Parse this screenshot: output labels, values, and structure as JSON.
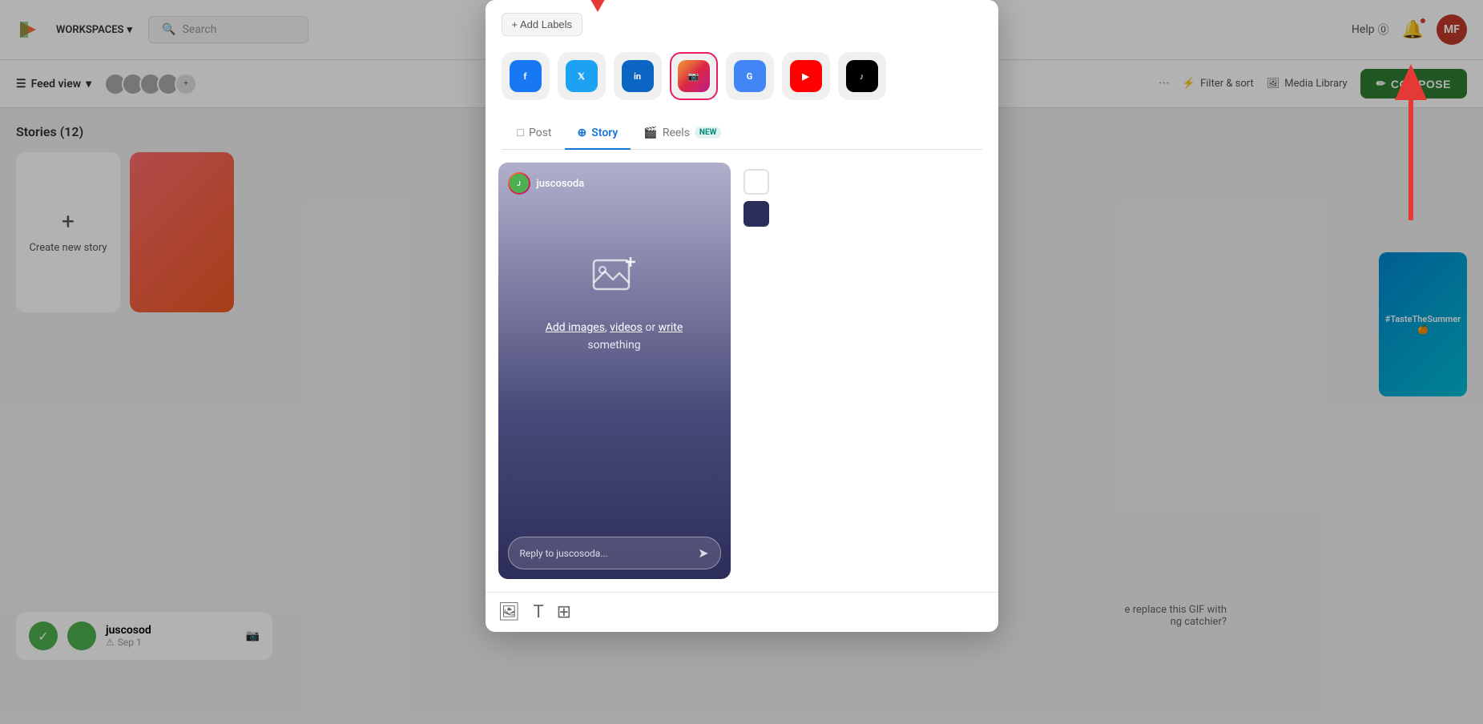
{
  "app": {
    "logo_text": "▶",
    "workspaces_label": "WORKSPACES",
    "search_placeholder": "Search",
    "help_label": "Help",
    "user_initials": "MF",
    "feed_view_label": "Feed view",
    "avatars_count": "3",
    "filter_sort_label": "Filter & sort",
    "media_library_label": "Media Library",
    "compose_label": "COMPOSE"
  },
  "stories": {
    "title": "Stories (12)",
    "create_label": "Create\nnew story"
  },
  "modal": {
    "add_labels_label": "+ Add Labels",
    "tabs": [
      {
        "id": "post",
        "label": "Post",
        "icon": "□",
        "is_new": false
      },
      {
        "id": "story",
        "label": "Story",
        "icon": "⊕",
        "is_new": false,
        "active": true
      },
      {
        "id": "reels",
        "label": "Reels",
        "icon": "🎬",
        "is_new": true
      }
    ],
    "platforms": [
      {
        "id": "facebook",
        "label": "FB",
        "class": "p-fb"
      },
      {
        "id": "twitter",
        "label": "TW",
        "class": "p-tw"
      },
      {
        "id": "linkedin",
        "label": "in",
        "class": "p-li"
      },
      {
        "id": "instagram",
        "label": "IG",
        "class": "p-ig",
        "active": true
      },
      {
        "id": "google",
        "label": "G",
        "class": "p-gg"
      },
      {
        "id": "youtube",
        "label": "YT",
        "class": "p-yt"
      },
      {
        "id": "tiktok",
        "label": "TT",
        "class": "p-tt"
      }
    ],
    "story_preview": {
      "username": "juscosoda",
      "add_images_text": "Add images",
      "videos_text": "videos",
      "or_text": "or",
      "write_text": "write",
      "something_text": "something",
      "reply_placeholder": "Reply to juscosoda..."
    },
    "colors": [
      {
        "id": "white",
        "class": "swatch-white"
      },
      {
        "id": "dark",
        "class": "swatch-dark"
      }
    ],
    "toolbar_icons": [
      "image",
      "text",
      "gallery"
    ]
  },
  "post_bottom": {
    "username": "juscosod",
    "date": "Sep 1",
    "status_icon": "✓"
  },
  "arrow_annotations": {
    "down_arrow": "pointing to Story tab",
    "up_arrow": "pointing to COMPOSE button"
  },
  "hint": {
    "replace_gif": "e replace this GIF with",
    "catchier": "ng catchier?"
  }
}
